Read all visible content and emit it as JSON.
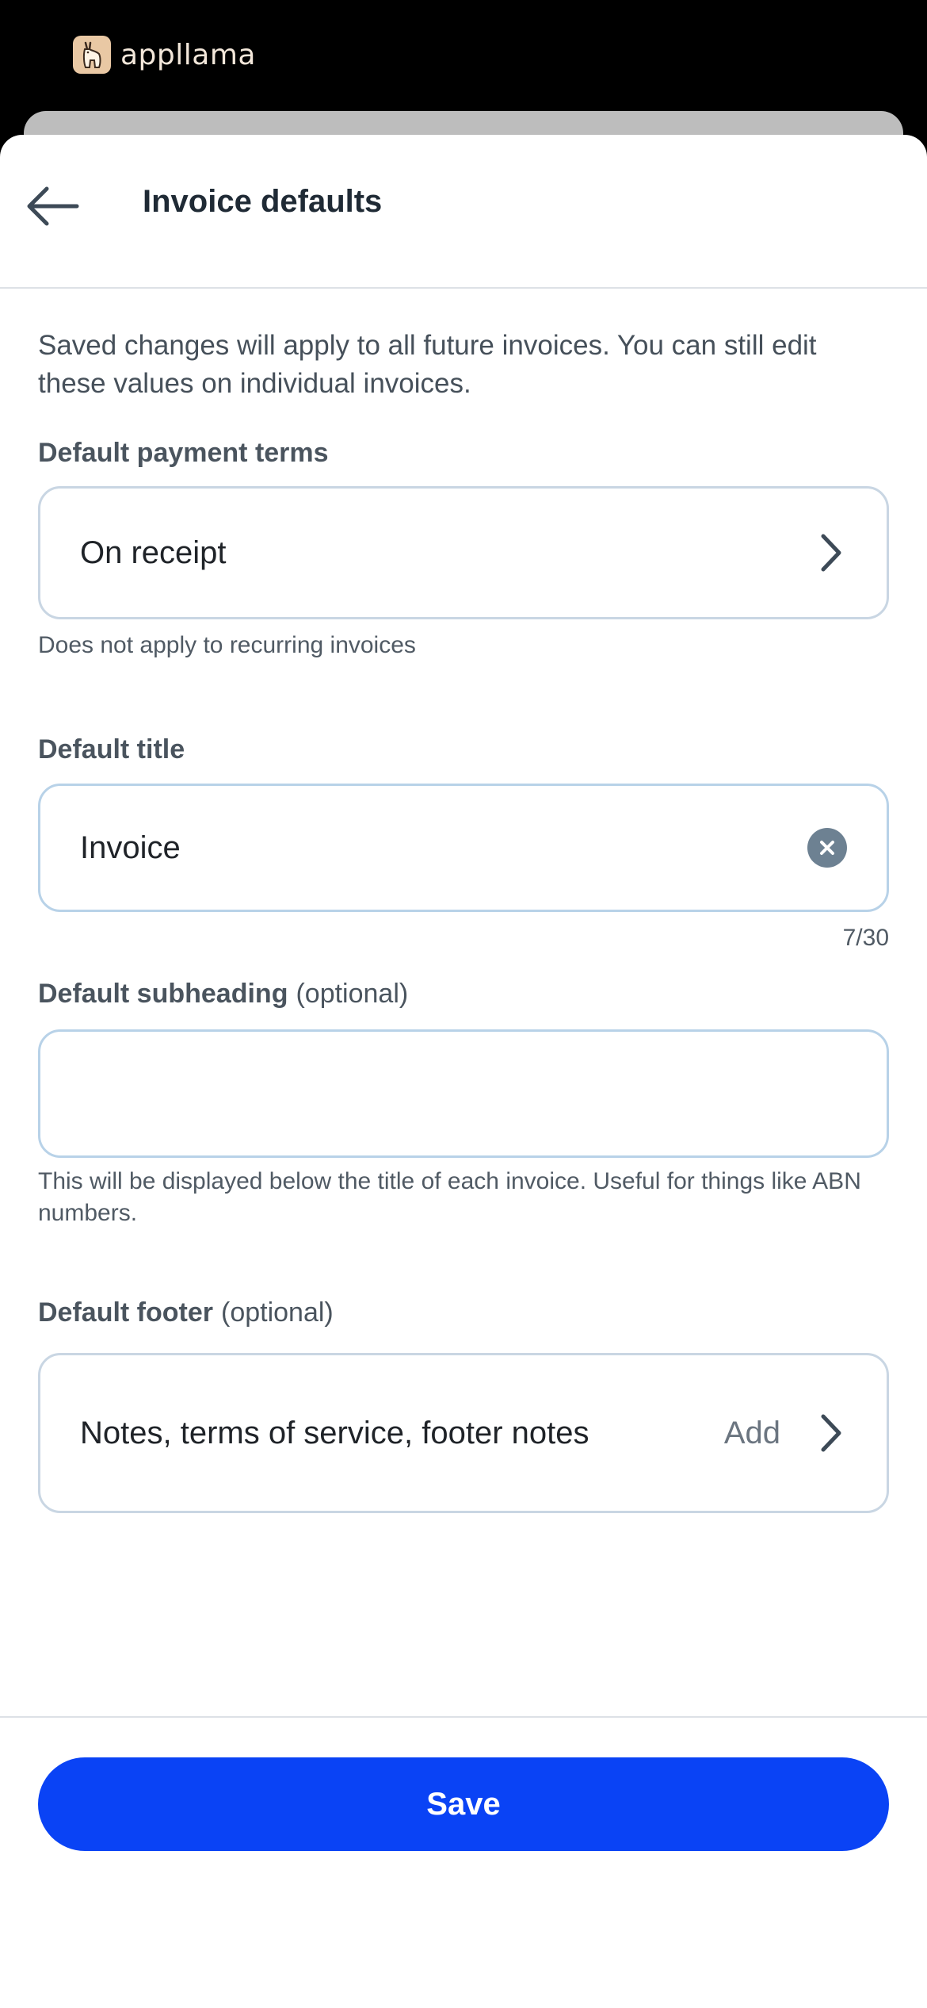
{
  "app": {
    "brand_name": "appllama"
  },
  "header": {
    "title": "Invoice defaults"
  },
  "intro": "Saved changes will apply to all future invoices. You can still edit these values on individual invoices.",
  "payment_terms": {
    "label": "Default payment terms",
    "value": "On receipt",
    "helper": "Does not apply to recurring invoices"
  },
  "title_field": {
    "label": "Default title",
    "value": "Invoice",
    "counter": "7/30"
  },
  "subheading": {
    "label": "Default subheading",
    "optional": "(optional)",
    "value": "",
    "helper": "This will be displayed below the title of each invoice. Useful for things like ABN numbers."
  },
  "footer_field": {
    "label": "Default footer",
    "optional": "(optional)",
    "value": "Notes, terms of service, footer notes",
    "action": "Add"
  },
  "save_label": "Save",
  "colors": {
    "primary": "#0a43f5",
    "border": "#c9d6e3",
    "text": "#1f2328"
  },
  "icons": [
    "llama-logo-icon",
    "back-arrow-icon",
    "chevron-right-icon",
    "clear-circle-icon"
  ]
}
